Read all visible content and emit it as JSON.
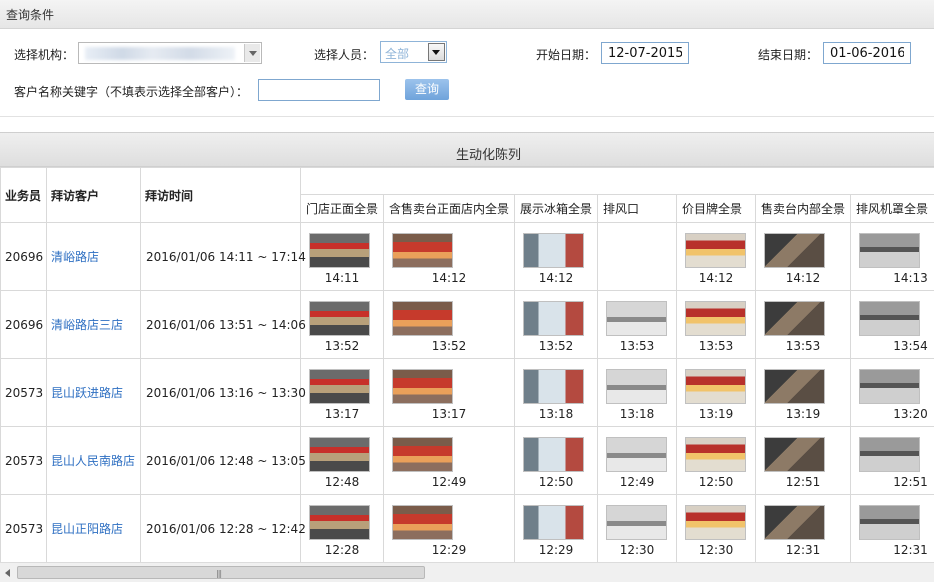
{
  "query": {
    "title": "查询条件",
    "org_label": "选择机构：",
    "person_label": "选择人员：",
    "person_value": "全部",
    "start_label": "开始日期：",
    "start_value": "12-07-2015",
    "end_label": "结束日期：",
    "end_value": "01-06-2016",
    "keyword_label": "客户名称关键字（不填表示选择全部客户）：",
    "keyword_value": "",
    "search_button": "查询"
  },
  "section_title": "生动化陈列",
  "table": {
    "headers": {
      "salesman": "业务员",
      "customer": "拜访客户",
      "visit_time": "拜访时间"
    },
    "photo_columns": [
      "门店正面全景",
      "含售卖台正面店内全景",
      "展示冰箱全景",
      "排风口",
      "价目牌全景",
      "售卖台内部全景",
      "排风机罩全景"
    ],
    "rows": [
      {
        "salesman": "20696",
        "customer": "清峪路店",
        "time": "2016/01/06 14:11 ~ 17:14",
        "photos": [
          "14:11",
          "14:12",
          "14:12",
          "",
          "14:12",
          "14:12",
          "14:13"
        ]
      },
      {
        "salesman": "20696",
        "customer": "清峪路店三店",
        "time": "2016/01/06 13:51 ~ 14:06",
        "photos": [
          "13:52",
          "13:52",
          "13:52",
          "13:53",
          "13:53",
          "13:53",
          "13:54"
        ]
      },
      {
        "salesman": "20573",
        "customer": "昆山跃进路店",
        "time": "2016/01/06 13:16 ~ 13:30",
        "photos": [
          "13:17",
          "13:17",
          "13:18",
          "13:18",
          "13:19",
          "13:19",
          "13:20"
        ]
      },
      {
        "salesman": "20573",
        "customer": "昆山人民南路店",
        "time": "2016/01/06 12:48 ~ 13:05",
        "photos": [
          "12:48",
          "12:49",
          "12:50",
          "12:49",
          "12:50",
          "12:51",
          "12:51"
        ]
      },
      {
        "salesman": "20573",
        "customer": "昆山正阳路店",
        "time": "2016/01/06 12:28 ~ 12:42",
        "photos": [
          "12:28",
          "12:29",
          "12:29",
          "12:30",
          "12:30",
          "12:31",
          "12:31"
        ]
      }
    ]
  }
}
